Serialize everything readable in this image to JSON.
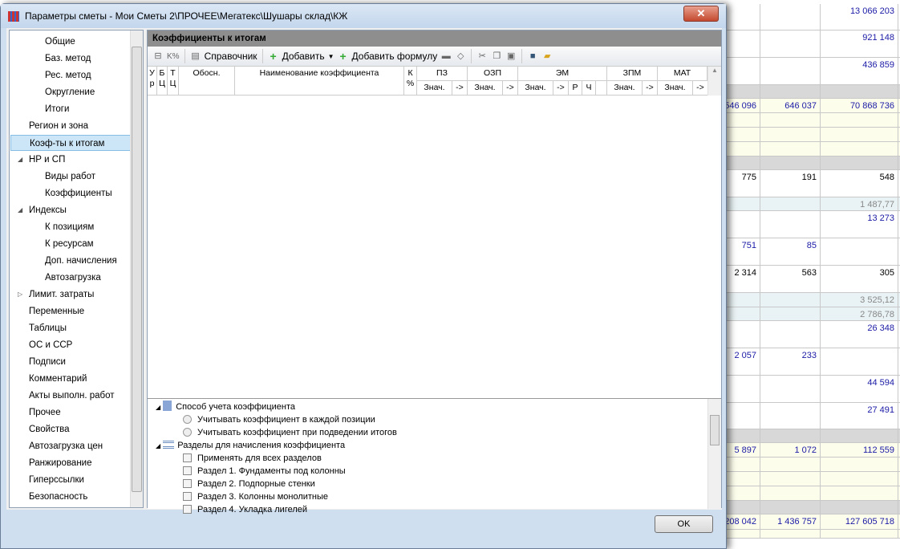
{
  "window": {
    "title": "Параметры сметы - Мои Сметы 2\\ПРОЧЕЕ\\Мегатекс\\Шушары склад\\КЖ",
    "close": "✕"
  },
  "sidebar": {
    "items": [
      {
        "label": "Общие",
        "level": 2
      },
      {
        "label": "Баз. метод",
        "level": 2
      },
      {
        "label": "Рес. метод",
        "level": 2
      },
      {
        "label": "Округление",
        "level": 2
      },
      {
        "label": "Итоги",
        "level": 2
      },
      {
        "label": "Регион и зона",
        "level": 1
      },
      {
        "label": "Коэф-ты к итогам",
        "level": 1,
        "selected": true
      },
      {
        "label": "НР и СП",
        "level": 1,
        "expander": "expanded"
      },
      {
        "label": "Виды работ",
        "level": 2
      },
      {
        "label": "Коэффициенты",
        "level": 2
      },
      {
        "label": "Индексы",
        "level": 1,
        "expander": "expanded"
      },
      {
        "label": "К позициям",
        "level": 2
      },
      {
        "label": "К ресурсам",
        "level": 2
      },
      {
        "label": "Доп. начисления",
        "level": 2
      },
      {
        "label": "Автозагрузка",
        "level": 2
      },
      {
        "label": "Лимит. затраты",
        "level": 1,
        "expander": "collapsed"
      },
      {
        "label": "Переменные",
        "level": 1
      },
      {
        "label": "Таблицы",
        "level": 1
      },
      {
        "label": "ОС и ССР",
        "level": 1
      },
      {
        "label": "Подписи",
        "level": 1
      },
      {
        "label": "Комментарий",
        "level": 1
      },
      {
        "label": "Акты выполн. работ",
        "level": 1
      },
      {
        "label": "Прочее",
        "level": 1
      },
      {
        "label": "Свойства",
        "level": 1
      },
      {
        "label": "Автозагрузка цен",
        "level": 1
      },
      {
        "label": "Ранжирование",
        "level": 1
      },
      {
        "label": "Гиперссылки",
        "level": 1
      },
      {
        "label": "Безопасность",
        "level": 1
      }
    ]
  },
  "main": {
    "title": "Коэффициенты к итогам",
    "toolbar": {
      "reference": "Справочник",
      "add": "Добавить",
      "add_formula": "Добавить формулу",
      "k_percent": "K%"
    },
    "columns": {
      "ur": "У р",
      "bc": "Б Ц",
      "tc": "Т Ц",
      "basis": "Обосн.",
      "name": "Наименование коэффициента",
      "kp": "К %",
      "groups": [
        "ПЗ",
        "ОЗП",
        "ЭМ",
        "ЗПМ",
        "МАТ"
      ],
      "val": "Знач.",
      "arrow": "->",
      "r": "Р",
      "ch": "Ч"
    }
  },
  "options": {
    "method_title": "Способ учета коэффициента",
    "method_options": [
      "Учитывать коэффициент в каждой позиции",
      "Учитывать коэффициент при подведении итогов"
    ],
    "sections_title": "Разделы для начисления коэффициента",
    "sections": [
      "Применять для всех разделов",
      "Раздел 1. Фундаменты под колонны",
      "Раздел 2. Подпорные стенки",
      "Раздел 3. Колонны монолитные",
      "Раздел 4. Укладка лигелей"
    ]
  },
  "ok": "OK",
  "background_sheet": {
    "colors": {
      "blue": "#1a1aa6",
      "black": "#000000",
      "gray": "#888888",
      "yellow": "#fdfdec",
      "lightblue": "#e9f2f4",
      "band": "#d8d8d8"
    },
    "rows": [
      {
        "bg": "white",
        "c": [
          "",
          "",
          "13 066 203"
        ],
        "col": "blue"
      },
      {
        "bg": "white",
        "c": [
          "",
          "",
          "921 148"
        ],
        "col": "blue"
      },
      {
        "bg": "white",
        "c": [
          "",
          "",
          "436 859"
        ],
        "col": "blue"
      },
      {
        "bg": "band",
        "c": [
          "",
          "",
          ""
        ]
      },
      {
        "bg": "yellow",
        "c": [
          "546 096",
          "646 037",
          "70 868 736"
        ],
        "col": "blue"
      },
      {
        "bg": "yellow",
        "c": [
          "",
          "",
          ""
        ]
      },
      {
        "bg": "yellow",
        "c": [
          "",
          "",
          ""
        ]
      },
      {
        "bg": "yellow",
        "c": [
          "",
          "",
          ""
        ]
      },
      {
        "bg": "band",
        "c": [
          "",
          "",
          ""
        ]
      },
      {
        "bg": "white",
        "c": [
          "775",
          "191",
          "548"
        ],
        "col": "black"
      },
      {
        "bg": "lightblue",
        "c": [
          "",
          "",
          "1 487,77"
        ],
        "col": "gray"
      },
      {
        "bg": "white",
        "c": [
          "",
          "",
          "13 273"
        ],
        "col": "blue"
      },
      {
        "bg": "white",
        "c": [
          "751",
          "85",
          ""
        ],
        "col": "blue"
      },
      {
        "bg": "white",
        "c": [
          "2 314",
          "563",
          "305"
        ],
        "col": "black"
      },
      {
        "bg": "lightblue",
        "c": [
          "",
          "",
          "3 525,12"
        ],
        "col": "gray"
      },
      {
        "bg": "lightblue",
        "c": [
          "",
          "",
          "2 786,78"
        ],
        "col": "gray"
      },
      {
        "bg": "white",
        "c": [
          "",
          "",
          "26 348"
        ],
        "col": "blue"
      },
      {
        "bg": "white",
        "c": [
          "2 057",
          "233",
          ""
        ],
        "col": "blue"
      },
      {
        "bg": "white",
        "c": [
          "",
          "",
          "44 594"
        ],
        "col": "blue"
      },
      {
        "bg": "white",
        "c": [
          "",
          "",
          "27 491"
        ],
        "col": "blue"
      },
      {
        "bg": "band",
        "c": [
          "",
          "",
          ""
        ]
      },
      {
        "bg": "yellow",
        "c": [
          "5 897",
          "1 072",
          "112 559"
        ],
        "col": "blue"
      },
      {
        "bg": "yellow",
        "c": [
          "",
          "",
          ""
        ]
      },
      {
        "bg": "yellow",
        "c": [
          "",
          "",
          ""
        ]
      },
      {
        "bg": "yellow",
        "c": [
          "",
          "",
          ""
        ]
      },
      {
        "bg": "band",
        "c": [
          "",
          "",
          ""
        ]
      },
      {
        "bg": "yellow",
        "c": [
          "208 042",
          "1 436 757",
          "127 605 718"
        ],
        "col": "blue"
      },
      {
        "bg": "yellow",
        "c": [
          "",
          "",
          ""
        ]
      }
    ]
  }
}
